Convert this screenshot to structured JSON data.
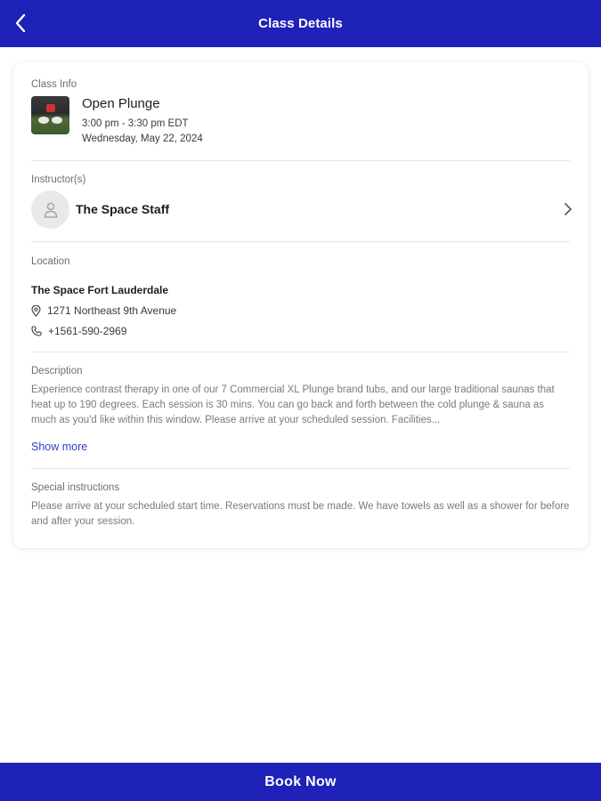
{
  "header": {
    "title": "Class Details",
    "back_icon": "chevron-left-icon"
  },
  "class_info": {
    "label": "Class Info",
    "name": "Open Plunge",
    "time": "3:00 pm - 3:30 pm EDT",
    "date": "Wednesday, May 22, 2024"
  },
  "instructors": {
    "label": "Instructor(s)",
    "name": "The Space Staff"
  },
  "location": {
    "label": "Location",
    "name": "The Space Fort Lauderdale",
    "address": "1271 Northeast 9th Avenue",
    "phone": "+1561-590-2969"
  },
  "description": {
    "label": "Description",
    "text": "Experience contrast therapy in one of our 7 Commercial XL Plunge brand tubs, and our large traditional saunas that heat up to 190 degrees.  Each session is 30 mins. You can go back and forth between the cold plunge & sauna as much as you'd like within this window. Please arrive at your scheduled session. Facilities...",
    "show_more": "Show more"
  },
  "special_instructions": {
    "label": "Special instructions",
    "text": "Please arrive at your scheduled start time. Reservations must be made. We have towels as well as a shower for before and after your session."
  },
  "footer": {
    "book_label": "Book Now"
  },
  "colors": {
    "brand": "#1e22b8",
    "link": "#2e3fc7"
  }
}
